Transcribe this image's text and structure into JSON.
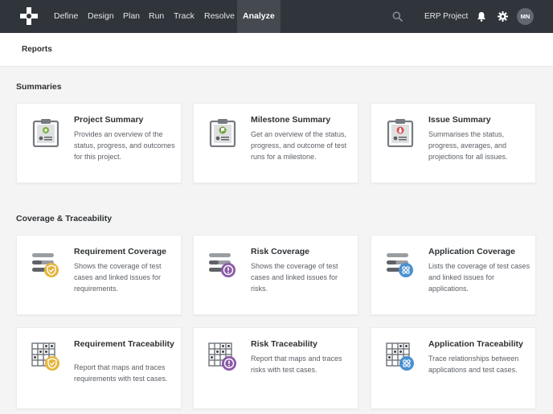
{
  "nav": {
    "items": [
      "Define",
      "Design",
      "Plan",
      "Run",
      "Track",
      "Resolve",
      "Analyze"
    ],
    "active": "Analyze",
    "project": "ERP Project",
    "avatar_initials": "MN"
  },
  "subheader": {
    "tab": "Reports"
  },
  "sections": [
    {
      "title": "Summaries",
      "cards": [
        {
          "title": "Project Summary",
          "desc": "Provides an overview of the status, progress, and outcomes for this project.",
          "icon": "clipboard-project-icon"
        },
        {
          "title": "Milestone Summary",
          "desc": "Get an overview of the status, progress, and outcome of test runs for a milestone.",
          "icon": "clipboard-milestone-icon"
        },
        {
          "title": "Issue Summary",
          "desc": "Summarises the status, progress, averages, and projections for all issues.",
          "icon": "clipboard-issue-icon"
        }
      ]
    },
    {
      "title": "Coverage & Traceability",
      "cards": [
        {
          "title": "Requirement Coverage",
          "desc": "Shows the coverage of test cases and linked issues for requirements.",
          "icon": "requirement-coverage-icon"
        },
        {
          "title": "Risk Coverage",
          "desc": "Shows the coverage of test cases and linked issues for risks.",
          "icon": "risk-coverage-icon"
        },
        {
          "title": "Application Coverage",
          "desc": "Lists the coverage of test cases and linked issues for applications.",
          "icon": "application-coverage-icon"
        },
        {
          "title": "Requirement Traceability",
          "desc": "Report that maps and traces requirements with test cases.",
          "icon": "requirement-traceability-icon"
        },
        {
          "title": "Risk Traceability",
          "desc": "Report that maps and traces risks with test cases.",
          "icon": "risk-traceability-icon"
        },
        {
          "title": "Application Traceability",
          "desc": "Trace relationships between applications and test cases.",
          "icon": "application-traceability-icon"
        }
      ]
    }
  ],
  "colors": {
    "topbar": "#30353b",
    "project_accent": "#7cb342",
    "milestone_accent": "#6fa23a",
    "issue_accent": "#d9534f",
    "requirement_accent": "#e5b43a",
    "risk_accent": "#8a5aa8",
    "application_accent": "#4a90d0"
  }
}
